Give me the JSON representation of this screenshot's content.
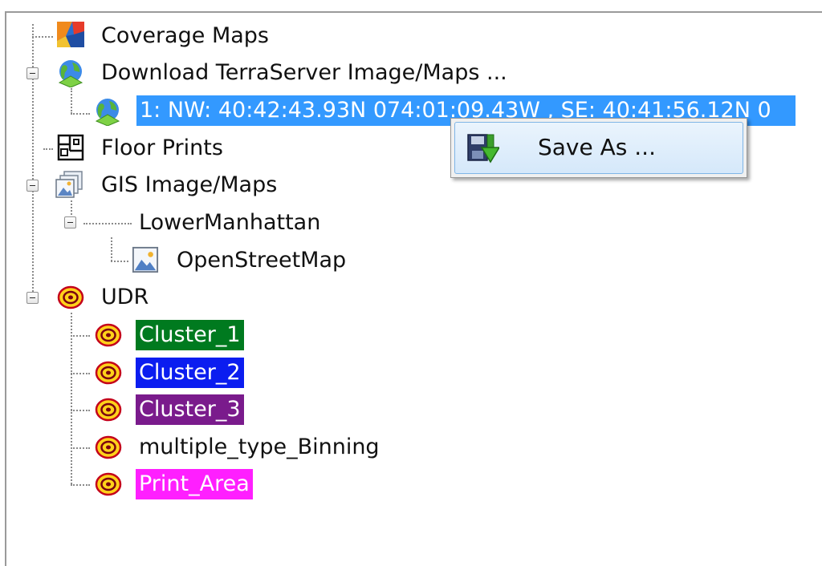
{
  "tree": {
    "nodes": [
      {
        "label": "Coverage Maps",
        "icon": "coverage-map-icon"
      },
      {
        "label": "Download TerraServer Image/Maps ...",
        "icon": "globe-download-icon"
      },
      {
        "label": "1: NW: 40:42:43.93N 074:01:09.43W , SE: 40:41:56.12N 0",
        "icon": "globe-download-icon",
        "selected": true
      },
      {
        "label": "Floor Prints",
        "icon": "floor-print-icon"
      },
      {
        "label": "GIS Image/Maps",
        "icon": "gis-images-icon"
      },
      {
        "label": "LowerManhattan",
        "icon": ""
      },
      {
        "label": "OpenStreetMap",
        "icon": "image-map-icon"
      },
      {
        "label": "UDR",
        "icon": "udr-icon"
      },
      {
        "label": "Cluster_1",
        "icon": "udr-icon",
        "highlight": "#007a1f"
      },
      {
        "label": "Cluster_2",
        "icon": "udr-icon",
        "highlight": "#0b1df0"
      },
      {
        "label": "Cluster_3",
        "icon": "udr-icon",
        "highlight": "#7a1b8c"
      },
      {
        "label": "multiple_type_Binning",
        "icon": "udr-icon"
      },
      {
        "label": "Print_Area",
        "icon": "udr-icon",
        "highlight": "#ff1fff"
      }
    ]
  },
  "context_menu": {
    "items": [
      {
        "label": "Save As ...",
        "icon": "save-as-icon"
      }
    ]
  },
  "colors": {
    "selection": "#3399ff",
    "menu_hover": "#d5e8fa"
  }
}
